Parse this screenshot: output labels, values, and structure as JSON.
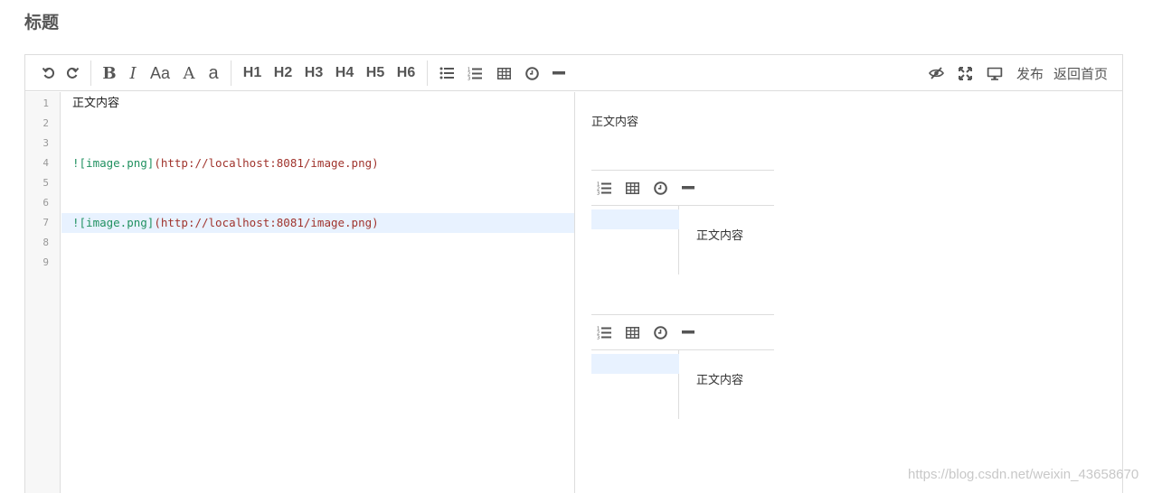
{
  "page": {
    "title": "标题"
  },
  "toolbar": {
    "headings": [
      "H1",
      "H2",
      "H3",
      "H4",
      "H5",
      "H6"
    ],
    "font_size_label": "Aa",
    "upper_a_label": "A",
    "lower_a_label": "a",
    "bold_label": "B",
    "italic_label": "I",
    "publish_label": "发布",
    "home_label": "返回首页"
  },
  "editor": {
    "line_numbers": [
      "1",
      "2",
      "3",
      "4",
      "5",
      "6",
      "7",
      "8",
      "9"
    ],
    "active_line": 7,
    "lines": [
      {
        "plain": "正文内容"
      },
      {
        "plain": ""
      },
      {
        "plain": ""
      },
      {
        "alt": "![image.png]",
        "url": "(http://localhost:8081/image.png)"
      },
      {
        "plain": ""
      },
      {
        "plain": ""
      },
      {
        "alt": "![image.png]",
        "url": "(http://localhost:8081/image.png)"
      },
      {
        "plain": ""
      },
      {
        "plain": ""
      }
    ]
  },
  "preview": {
    "text": "正文内容",
    "images": [
      {
        "text": "正文内容"
      },
      {
        "text": "正文内容"
      }
    ]
  },
  "icons": {
    "undo": "undo-icon",
    "redo": "redo-icon",
    "bold": "bold-icon",
    "italic": "italic-icon",
    "font_size": "font-size-icon",
    "uppercase": "uppercase-icon",
    "lowercase": "lowercase-icon",
    "unordered_list": "unordered-list-icon",
    "ordered_list": "ordered-list-icon",
    "table": "table-icon",
    "clock": "clock-icon",
    "hr": "horizontal-rule-icon",
    "preview_toggle": "eye-slash-icon",
    "fullscreen": "fullscreen-icon",
    "desktop": "desktop-icon"
  },
  "colors": {
    "active_line": "#e8f2ff",
    "alt_text": "#219161",
    "url_text": "#a0342d",
    "border": "#dddddd"
  },
  "watermark": "https://blog.csdn.net/weixin_43658670"
}
